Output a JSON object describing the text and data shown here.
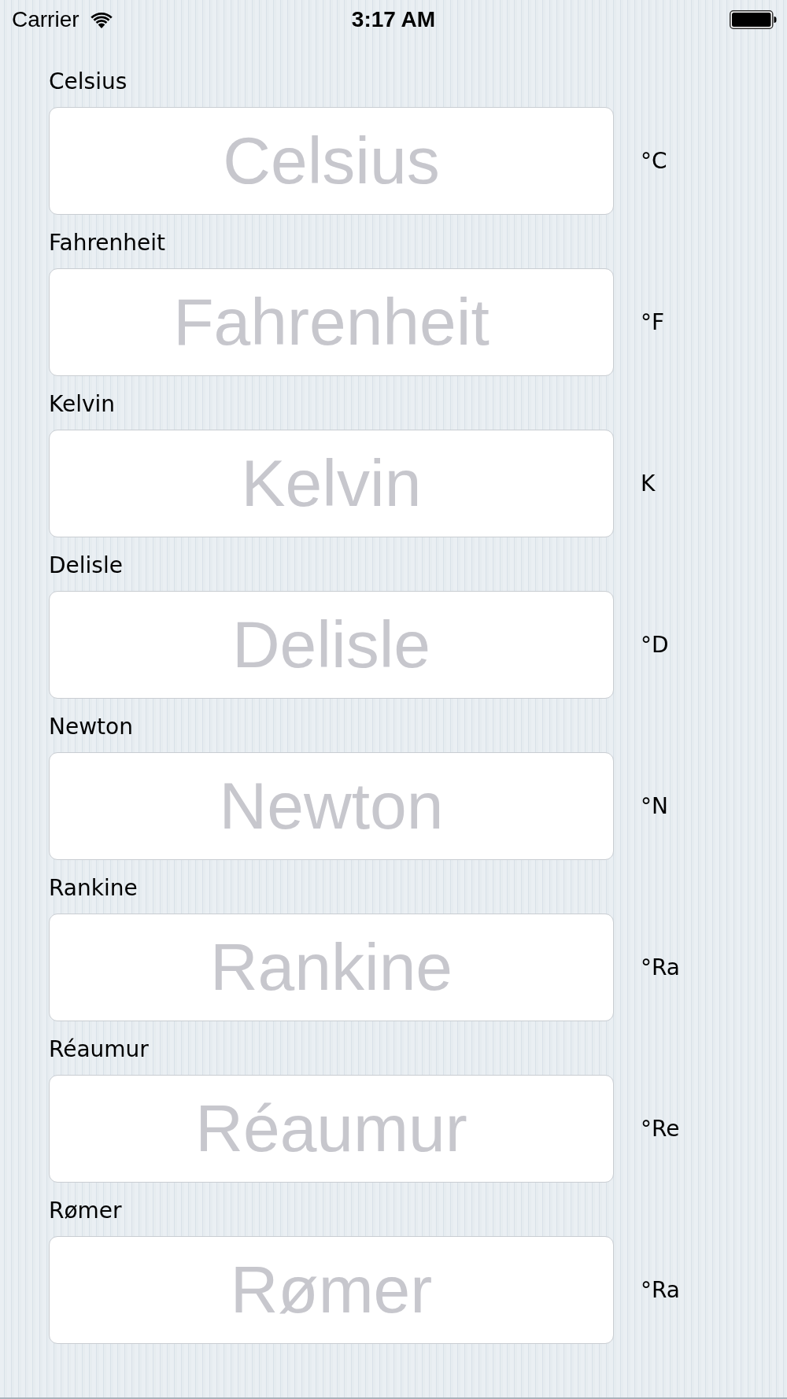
{
  "status_bar": {
    "carrier": "Carrier",
    "time": "3:17 AM"
  },
  "scales": [
    {
      "label": "Celsius",
      "placeholder": "Celsius",
      "unit": "°C"
    },
    {
      "label": "Fahrenheit",
      "placeholder": "Fahrenheit",
      "unit": "°F"
    },
    {
      "label": "Kelvin",
      "placeholder": "Kelvin",
      "unit": "K"
    },
    {
      "label": "Delisle",
      "placeholder": "Delisle",
      "unit": "°D"
    },
    {
      "label": "Newton",
      "placeholder": "Newton",
      "unit": "°N"
    },
    {
      "label": "Rankine",
      "placeholder": "Rankine",
      "unit": "°Ra"
    },
    {
      "label": "Réaumur",
      "placeholder": "Réaumur",
      "unit": "°Re"
    },
    {
      "label": "Rømer",
      "placeholder": "Rømer",
      "unit": "°Ra"
    }
  ]
}
